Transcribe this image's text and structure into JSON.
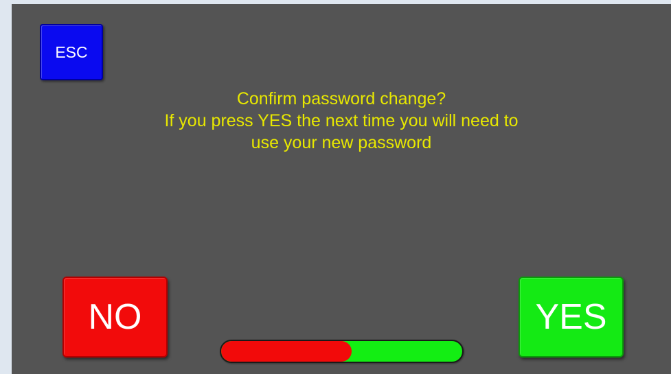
{
  "buttons": {
    "esc_label": "ESC",
    "no_label": "NO",
    "yes_label": "YES"
  },
  "message": {
    "line1": "Confirm password change?",
    "line2": "If you press YES the next time you will need to",
    "line3": "use your new password"
  },
  "progress": {
    "fraction": 0.54
  },
  "colors": {
    "background": "#545454",
    "message_text": "#e8e800",
    "esc_button": "#0a0af0",
    "no_button": "#f20b0b",
    "yes_button": "#14ea14",
    "progress_fill": "#f20a0a",
    "progress_track": "#13ee13"
  }
}
